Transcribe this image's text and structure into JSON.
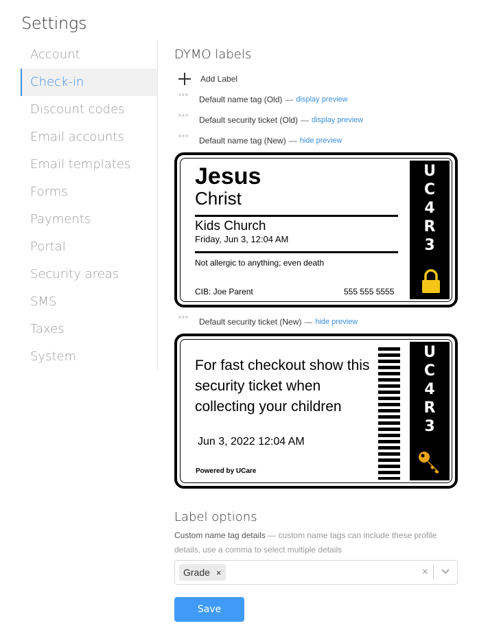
{
  "page": {
    "title": "Settings"
  },
  "sidebar": {
    "items": [
      {
        "label": "Account"
      },
      {
        "label": "Check-in",
        "active": true
      },
      {
        "label": "Discount codes"
      },
      {
        "label": "Email accounts"
      },
      {
        "label": "Email templates"
      },
      {
        "label": "Forms"
      },
      {
        "label": "Payments"
      },
      {
        "label": "Portal"
      },
      {
        "label": "Security areas"
      },
      {
        "label": "SMS"
      },
      {
        "label": "Taxes"
      },
      {
        "label": "System"
      }
    ]
  },
  "dymo": {
    "title": "DYMO labels",
    "add_label": "Add Label",
    "separator": "—",
    "labels": [
      {
        "name": "Default name tag (Old)",
        "action": "display preview"
      },
      {
        "name": "Default security ticket (Old)",
        "action": "display preview"
      },
      {
        "name": "Default name tag (New)",
        "action": "hide preview"
      },
      {
        "name": "Default security ticket (New)",
        "action": "hide preview"
      }
    ]
  },
  "name_tag_preview": {
    "first_name": "Jesus",
    "last_name": "Christ",
    "group": "Kids Church",
    "datetime": "Friday, Jun 3, 12:04 AM",
    "allergy": "Not allergic to anything; even death",
    "checked_in_by": "CIB: Joe Parent",
    "phone": "555 555 5555",
    "code": [
      "U",
      "C",
      "4",
      "R",
      "3"
    ],
    "icon": "lock-icon"
  },
  "security_ticket_preview": {
    "message": "For fast checkout show this security ticket when collecting your children",
    "datetime": "Jun 3, 2022 12:04 AM",
    "powered_by": "Powered by UCare",
    "code": [
      "U",
      "C",
      "4",
      "R",
      "3"
    ],
    "icon": "key-icon"
  },
  "label_options": {
    "title": "Label options",
    "field_label": "Custom name tag details",
    "field_help": "— custom name tags can include these profile details, use a comma to select multiple details",
    "selected": [
      "Grade"
    ],
    "clear_glyph": "×",
    "remove_glyph": "×"
  },
  "save_label": "Save",
  "colors": {
    "accent": "#3a8fdf",
    "save_button": "#3f9bf7",
    "lock": "#f5c518",
    "key": "#e8a318"
  }
}
